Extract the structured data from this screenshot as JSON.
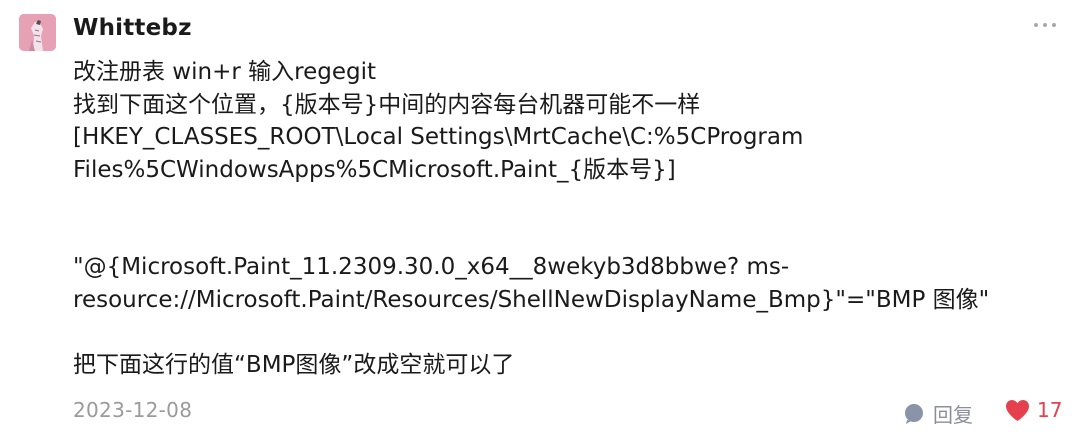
{
  "comment": {
    "username": "Whittebz",
    "more_icon": "more-dots-icon",
    "lines_block1": [
      "改注册表 win+r 输入regegit",
      "找到下面这个位置，{版本号}中间的内容每台机器可能不一样",
      "[HKEY_CLASSES_ROOT\\Local Settings\\MrtCache\\C:%5CProgram",
      "Files%5CWindowsApps%5CMicrosoft.Paint_{版本号}]"
    ],
    "lines_block2": [
      "\"@{Microsoft.Paint_11.2309.30.0_x64__8wekyb3d8bbwe? ms-",
      "resource://Microsoft.Paint/Resources/ShellNewDisplayName_Bmp}\"=\"BMP 图像\""
    ],
    "lines_block3": [
      "把下面这行的值“BMP图像”改成空就可以了"
    ],
    "date": "2023-12-08",
    "reply_label": "回复",
    "reply_icon": "comment-bubble-icon",
    "like_count": "17",
    "like_icon": "heart-icon",
    "colors": {
      "like": "#e5404d",
      "meta": "#9a9a9a",
      "reply_icon": "#8a94a8"
    }
  }
}
